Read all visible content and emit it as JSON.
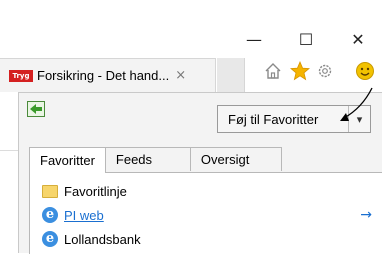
{
  "window": {
    "minimize_glyph": "—",
    "maximize_glyph": "☐",
    "close_glyph": "✕"
  },
  "browser_tab": {
    "logo_text": "Tryg",
    "title": "Forsikring - Det hand...",
    "close_glyph": "×"
  },
  "toolbar": {
    "home_icon": "home-icon",
    "favorites_icon": "star-icon",
    "settings_icon": "gear-icon",
    "feedback_icon": "smiley-icon",
    "star_color": "#f5b400",
    "smiley_color": "#f2c200"
  },
  "favorites_center": {
    "pin_icon": "pin-to-left-icon",
    "add_button_label": "Føj til Favoritter",
    "add_button_dropdown_glyph": "▾",
    "tabs": [
      {
        "label": "Favoritter",
        "active": true
      },
      {
        "label": "Feeds",
        "active": false
      },
      {
        "label": "Oversigt",
        "active": false
      }
    ],
    "items": [
      {
        "label": "Favoritlinje",
        "type": "folder"
      },
      {
        "label": "PI web",
        "type": "link",
        "hovered": true,
        "go_glyph": "→"
      },
      {
        "label": "Lollandsbank",
        "type": "page"
      }
    ]
  }
}
